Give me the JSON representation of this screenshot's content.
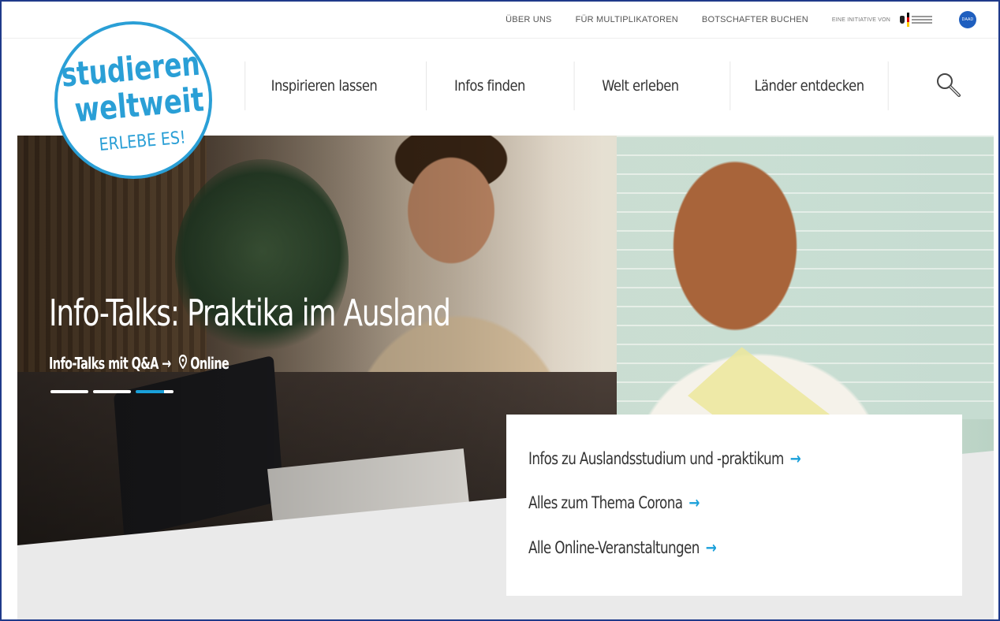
{
  "topbar": {
    "links": [
      "ÜBER UNS",
      "FÜR MULTIPLIKATOREN",
      "BOTSCHAFTER BUCHEN"
    ],
    "initiative": "EINE INITIATIVE VON",
    "daad": "DAAD"
  },
  "logo": {
    "line1": "studieren",
    "line2": "weltweit",
    "line3": "ERLEBE ES!"
  },
  "nav": {
    "items": [
      "Inspirieren lassen",
      "Infos finden",
      "Welt erleben",
      "Länder entdecken"
    ]
  },
  "search": {
    "icon": "search-icon"
  },
  "hero": {
    "title": "Info-Talks: Praktika im Ausland",
    "subtitle": "Info-Talks mit Q&A",
    "location": "Online",
    "slides": 3,
    "active_slide": 3
  },
  "links": [
    "Infos zu Auslandsstudium und -praktikum",
    "Alles zum Thema Corona",
    "Alle Online-Veranstaltungen"
  ],
  "colors": {
    "accent": "#1aa0da",
    "logo": "#2a9fd6",
    "frame": "#1f3a8a"
  }
}
